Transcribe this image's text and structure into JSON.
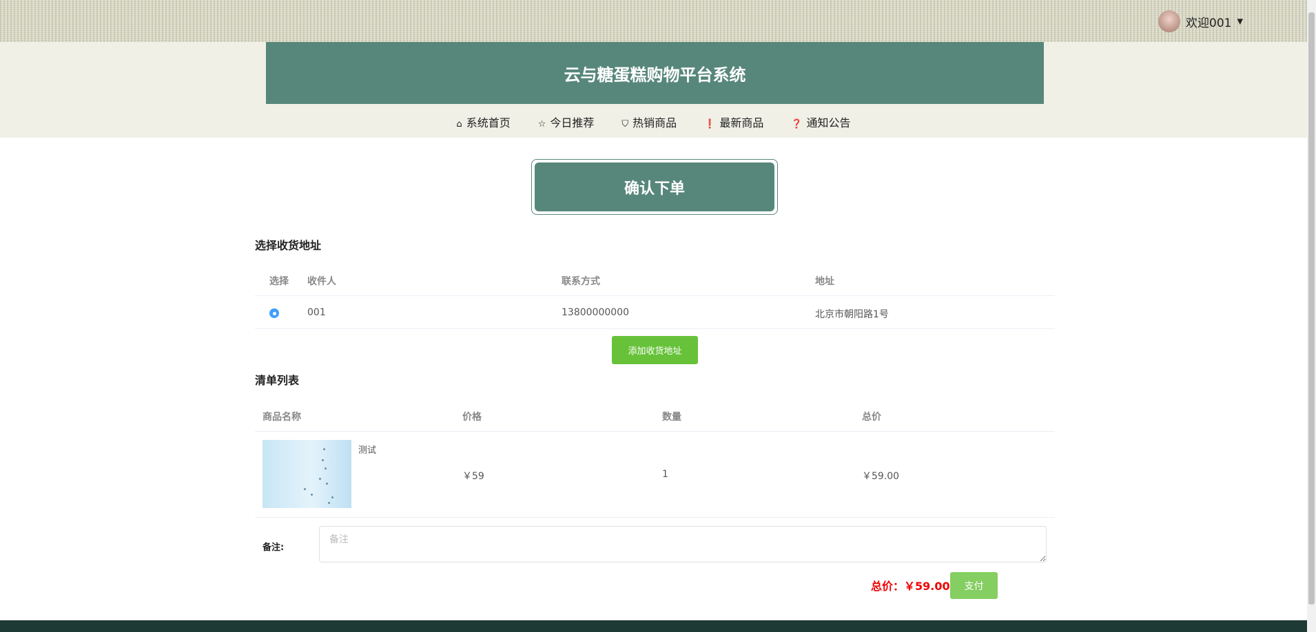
{
  "user": {
    "greeting": "欢迎001",
    "caret": "▾"
  },
  "site": {
    "title": "云与糖蛋糕购物平台系统"
  },
  "nav": [
    {
      "label": "系统首页",
      "icon": "⌂"
    },
    {
      "label": "今日推荐",
      "icon": "☆"
    },
    {
      "label": "热销商品",
      "icon": "⛉"
    },
    {
      "label": "最新商品",
      "icon": "❗"
    },
    {
      "label": "通知公告",
      "icon": "❓"
    }
  ],
  "page": {
    "title": "确认下单"
  },
  "address": {
    "heading": "选择收货地址",
    "columns": [
      "选择",
      "收件人",
      "联系方式",
      "地址"
    ],
    "rows": [
      {
        "selected": true,
        "name": "001",
        "phone": "13800000000",
        "address": "北京市朝阳路1号"
      }
    ],
    "add_label": "添加收货地址"
  },
  "list": {
    "heading": "清单列表",
    "columns": [
      "商品名称",
      "价格",
      "数量",
      "总价"
    ],
    "rows": [
      {
        "name": "测试",
        "price": "￥59",
        "qty": "1",
        "total": "￥59.00"
      }
    ]
  },
  "remark": {
    "label": "备注:",
    "placeholder": "备注"
  },
  "summary": {
    "total": "总价：￥59.00",
    "pay_label": "支付"
  },
  "colors": {
    "brand": "#57877a",
    "success": "#67c23a",
    "price": "#ee0000",
    "footer": "#1e3a34"
  }
}
